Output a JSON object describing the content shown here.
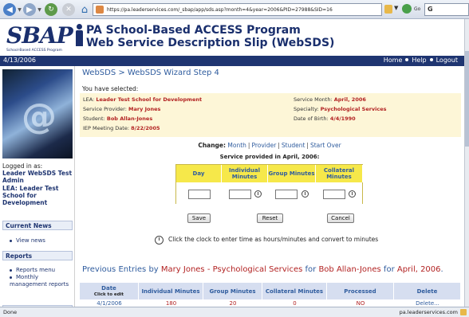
{
  "browser": {
    "url": "https://pa.leaderservices.com/_sbap/app/sds.asp?month=4&year=2006&PID=27988&SID=16",
    "search_label": "G",
    "go_label": "Go",
    "status_left": "Done",
    "status_right": "pa.leaderservices.com"
  },
  "header": {
    "logo_text": "SBAP",
    "logo_sub": "School-Based ACCESS Program",
    "title_line1": "PA School-Based ACCESS Program",
    "title_line2": "Web Service Description Slip (WebSDS)"
  },
  "navbar": {
    "date": "4/13/2006",
    "links": [
      "Home",
      "Help",
      "Logout"
    ]
  },
  "sidebar": {
    "logged_label": "Logged in as:",
    "user": "Leader WebSDS Test Admin",
    "lea": "LEA: Leader Test School for Development",
    "news_heading": "Current News",
    "news_item": "View news",
    "reports_heading": "Reports",
    "report_items": [
      "Reports menu",
      "Monthly management reports"
    ]
  },
  "main": {
    "breadcrumb": "WebSDS > WebSDS Wizard Step 4",
    "selected_label": "You have selected:",
    "info": {
      "lea_label": "LEA:",
      "lea_value": "Leader Test School for Development",
      "provider_label": "Service Provider:",
      "provider_value": "Mary Jones",
      "student_label": "Student:",
      "student_value": "Bob Allan-Jones",
      "iep_label": "IEP Meeting Date:",
      "iep_value": "8/22/2005",
      "month_label": "Service Month:",
      "month_value": "April, 2006",
      "specialty_label": "Specialty:",
      "specialty_value": "Psychological Services",
      "dob_label": "Date of Birth:",
      "dob_value": "4/4/1990"
    },
    "change_label": "Change:",
    "change_links": [
      "Month",
      "Provider",
      "Student",
      "Start Over"
    ],
    "provided_label": "Service provided in April, 2006:",
    "entry_headers": [
      "Day",
      "Individual Minutes",
      "Group Minutes",
      "Collateral Minutes"
    ],
    "buttons": {
      "save": "Save",
      "reset": "Reset",
      "cancel": "Cancel"
    },
    "hint": "Click the clock to enter time as hours/minutes and convert to minutes",
    "prev_title": {
      "prefix": "Previous Entries by ",
      "provider": "Mary Jones - Psychological Services",
      "mid1": " for ",
      "student": "Bob Allan-Jones",
      "mid2": " for ",
      "month": "April, 2006",
      "suffix": "."
    },
    "prev_headers": [
      "Date",
      "Individual Minutes",
      "Group Minutes",
      "Collateral Minutes",
      "Processed",
      "Delete"
    ],
    "prev_date_sub": "Click to edit",
    "prev_row": [
      "4/1/2006",
      "180",
      "20",
      "0",
      "NO",
      "Delete..."
    ]
  }
}
